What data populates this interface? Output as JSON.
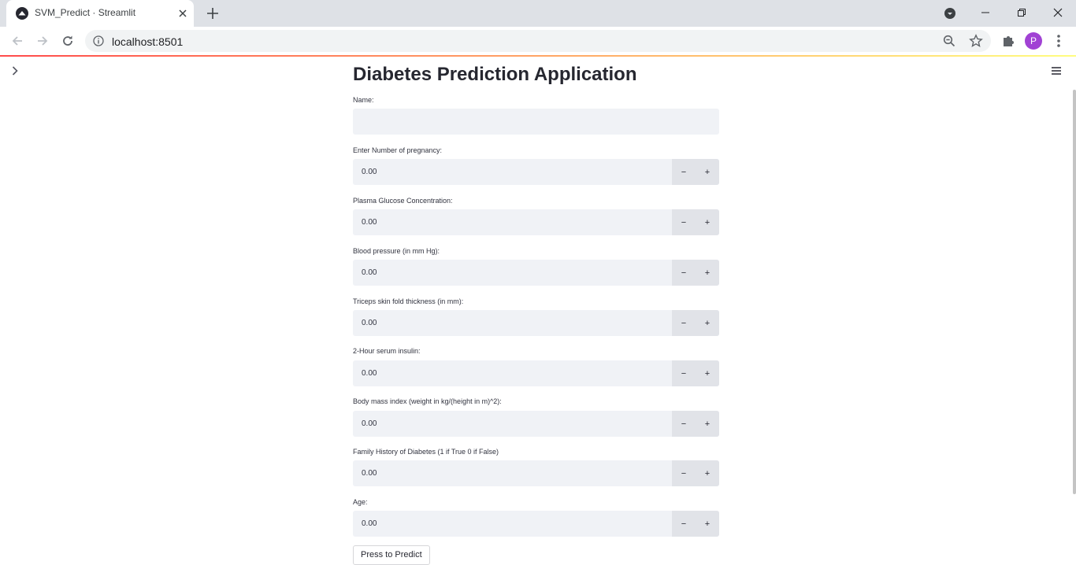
{
  "browser": {
    "tab_title": "SVM_Predict · Streamlit",
    "url": "localhost:8501",
    "profile_initial": "P",
    "icons": [
      "streamlit-favicon-icon",
      "close-icon",
      "plus-icon",
      "tab-search-icon",
      "minimize-icon",
      "restore-icon",
      "window-close-icon",
      "back-arrow-icon",
      "forward-arrow-icon",
      "reload-icon",
      "info-icon",
      "zoom-icon",
      "star-icon",
      "puzzle-icon",
      "more-vert-icon"
    ]
  },
  "app": {
    "title": "Diabetes Prediction Application",
    "name_label": "Name:",
    "name_value": "",
    "fields": [
      {
        "label": "Enter Number of pregnancy:",
        "value": "0.00"
      },
      {
        "label": "Plasma Glucose Concentration:",
        "value": "0.00"
      },
      {
        "label": "Blood pressure (in mm Hg):",
        "value": "0.00"
      },
      {
        "label": "Triceps skin fold thickness (in mm):",
        "value": "0.00"
      },
      {
        "label": "2-Hour serum insulin:",
        "value": "0.00"
      },
      {
        "label": "Body mass index (weight in kg/(height in m)^2):",
        "value": "0.00"
      },
      {
        "label": "Family History of Diabetes (1 if True 0 if False)",
        "value": "0.00"
      },
      {
        "label": "Age:",
        "value": "0.00"
      }
    ],
    "stepper": {
      "minus": "−",
      "plus": "+"
    },
    "predict_button": "Press to Predict",
    "accent_colors": [
      "#ff4b4b",
      "#fffd80"
    ],
    "icons": [
      "chevron-right-icon",
      "hamburger-menu-icon"
    ]
  }
}
